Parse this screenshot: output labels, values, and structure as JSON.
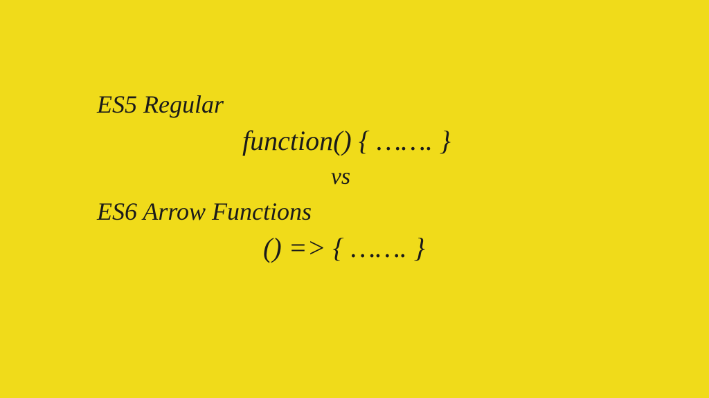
{
  "content": {
    "es5_title": "ES5 Regular",
    "es5_syntax": "function() {   …….   }",
    "versus": "vs",
    "es6_title": "ES6 Arrow Functions",
    "es6_syntax": "() => {   …….   }"
  }
}
